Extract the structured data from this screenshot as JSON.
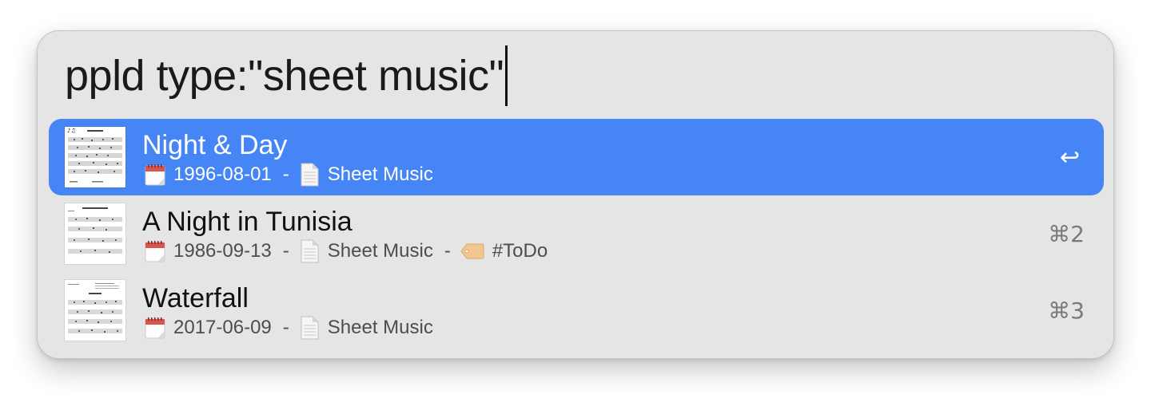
{
  "search": {
    "query": "ppld type:\"sheet music\""
  },
  "results": [
    {
      "title": "Night & Day",
      "date": "1996-08-01",
      "separator": "-",
      "kind": "Sheet Music",
      "tag": null,
      "shortcut": "↩",
      "selected": true
    },
    {
      "title": "A Night in Tunisia",
      "date": "1986-09-13",
      "separator": "-",
      "kind": "Sheet Music",
      "tag": "#ToDo",
      "shortcut": "⌘2",
      "selected": false
    },
    {
      "title": "Waterfall",
      "date": "2017-06-09",
      "separator": "-",
      "kind": "Sheet Music",
      "tag": null,
      "shortcut": "⌘3",
      "selected": false
    }
  ],
  "icons": {
    "calendar": "calendar-icon",
    "document": "document-icon",
    "tag": "tag-icon"
  },
  "colors": {
    "selection": "#4585f5",
    "panel": "#e5e5e5",
    "tag_fill": "#f3c68f"
  }
}
